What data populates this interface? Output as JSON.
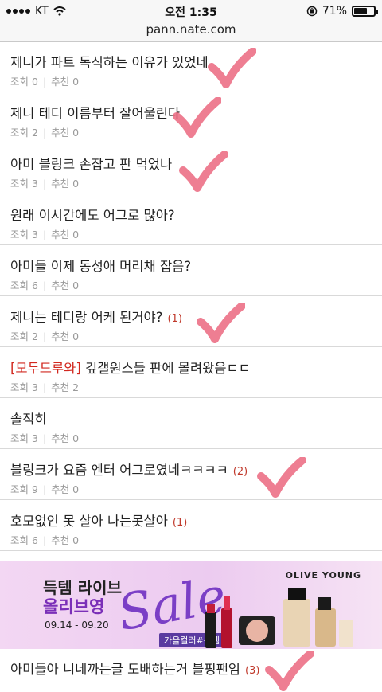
{
  "status": {
    "carrier": "KT",
    "time": "오전 1:35",
    "battery": "71%",
    "battery_level": 0.71
  },
  "url": "pann.nate.com",
  "meta_labels": {
    "views": "조회",
    "recommends": "추천"
  },
  "posts": [
    {
      "title": "제니가 파트 독식하는 이유가 있었네",
      "prefix": "",
      "comments": "",
      "views": "0",
      "recommends": "0"
    },
    {
      "title": "제니 테디 이름부터 잘어울린다",
      "prefix": "",
      "comments": "",
      "views": "2",
      "recommends": "0"
    },
    {
      "title": "아미 블링크 손잡고 판 먹었나",
      "prefix": "",
      "comments": "",
      "views": "3",
      "recommends": "0"
    },
    {
      "title": "원래 이시간에도 어그로 많아?",
      "prefix": "",
      "comments": "",
      "views": "3",
      "recommends": "0"
    },
    {
      "title": "아미들 이제 동성애 머리채 잡음?",
      "prefix": "",
      "comments": "",
      "views": "6",
      "recommends": "0"
    },
    {
      "title": "제니는 테디랑 어케 된거야?",
      "prefix": "",
      "comments": "(1)",
      "views": "2",
      "recommends": "0"
    },
    {
      "title": " 깊갤원스들 판에 몰려왔음ㄷㄷ",
      "prefix": "[모두드루와]",
      "comments": "",
      "views": "3",
      "recommends": "2"
    },
    {
      "title": "솔직히",
      "prefix": "",
      "comments": "",
      "views": "3",
      "recommends": "0"
    },
    {
      "title": "블링크가 요즘 엔터 어그로였네ㅋㅋㅋㅋ",
      "prefix": "",
      "comments": "(2)",
      "views": "9",
      "recommends": "0"
    },
    {
      "title": "호모없인 못 살아 나는못살아",
      "prefix": "",
      "comments": "(1)",
      "views": "6",
      "recommends": "0"
    }
  ],
  "banner": {
    "line1": "득템 라이브",
    "line2": "올리브영",
    "dates": "09.14 - 09.20",
    "sale": "Sale",
    "tag": "가을컬러#득템",
    "logo": "OLIVE YOUNG",
    "accent": "#7b3fc6"
  },
  "last_post": {
    "title": "아미들아 니네까는글 도배하는거 블핑팬임",
    "comments": "(3)"
  },
  "colors": {
    "check": "#e8536e",
    "prefix": "#d2281f",
    "comment_count": "#c0392b",
    "meta": "#9a9a9a"
  }
}
